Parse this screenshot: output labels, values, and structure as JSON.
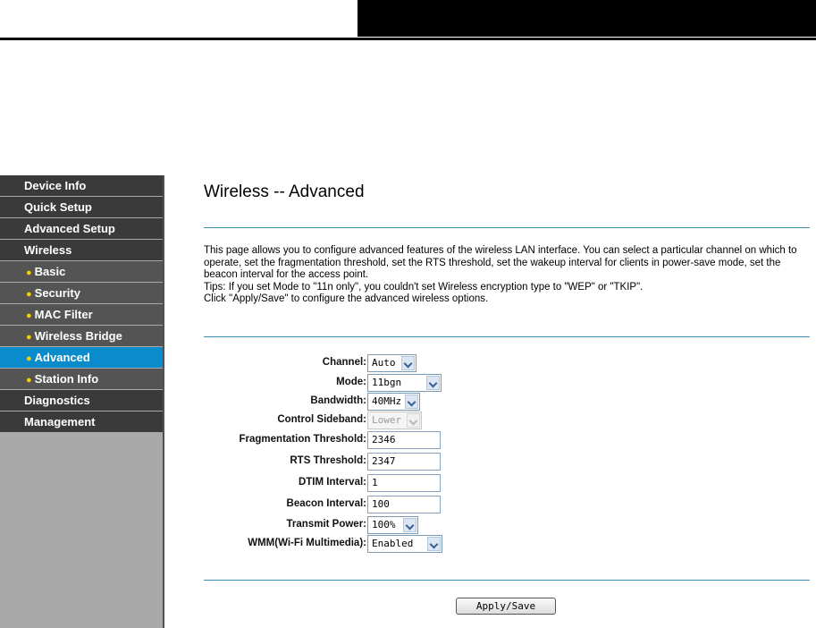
{
  "sidebar": {
    "items": [
      {
        "label": "Device Info",
        "sub": false,
        "active": false
      },
      {
        "label": "Quick Setup",
        "sub": false,
        "active": false
      },
      {
        "label": "Advanced Setup",
        "sub": false,
        "active": false
      },
      {
        "label": "Wireless",
        "sub": false,
        "active": false
      },
      {
        "label": "Basic",
        "sub": true,
        "active": false
      },
      {
        "label": "Security",
        "sub": true,
        "active": false
      },
      {
        "label": "MAC Filter",
        "sub": true,
        "active": false
      },
      {
        "label": "Wireless Bridge",
        "sub": true,
        "active": false
      },
      {
        "label": "Advanced",
        "sub": true,
        "active": true
      },
      {
        "label": "Station Info",
        "sub": true,
        "active": false
      },
      {
        "label": "Diagnostics",
        "sub": false,
        "active": false
      },
      {
        "label": "Management",
        "sub": false,
        "active": false
      }
    ]
  },
  "main": {
    "title": "Wireless -- Advanced",
    "description": [
      "This page allows you to configure advanced features of the wireless LAN interface. You can select a particular channel on which to operate, set the fragmentation threshold, set the RTS threshold, set the wakeup interval for clients in power-save mode, set the beacon interval for the access point.",
      "Tips: If you set Mode to \"11n only\", you couldn't set Wireless encryption type to \"WEP\" or \"TKIP\".",
      "Click \"Apply/Save\" to configure the advanced wireless options."
    ],
    "fields": {
      "channel": {
        "label": "Channel:",
        "value": "Auto"
      },
      "mode": {
        "label": "Mode:",
        "value": "11bgn"
      },
      "bandwidth": {
        "label": "Bandwidth:",
        "value": "40MHz"
      },
      "sideband": {
        "label": "Control Sideband:",
        "value": "Lower"
      },
      "frag": {
        "label": "Fragmentation Threshold:",
        "value": "2346"
      },
      "rts": {
        "label": "RTS Threshold:",
        "value": "2347"
      },
      "dtim": {
        "label": "DTIM Interval:",
        "value": "1"
      },
      "beacon": {
        "label": "Beacon Interval:",
        "value": "100"
      },
      "power": {
        "label": "Transmit Power:",
        "value": "100%"
      },
      "wmm": {
        "label": "WMM(Wi-Fi Multimedia):",
        "value": "Enabled"
      }
    },
    "apply_label": "Apply/Save"
  },
  "colors": {
    "active_nav": "#0a8bcc",
    "nav_bg": "#3a3a3a",
    "rule": "#3b8fb3"
  }
}
